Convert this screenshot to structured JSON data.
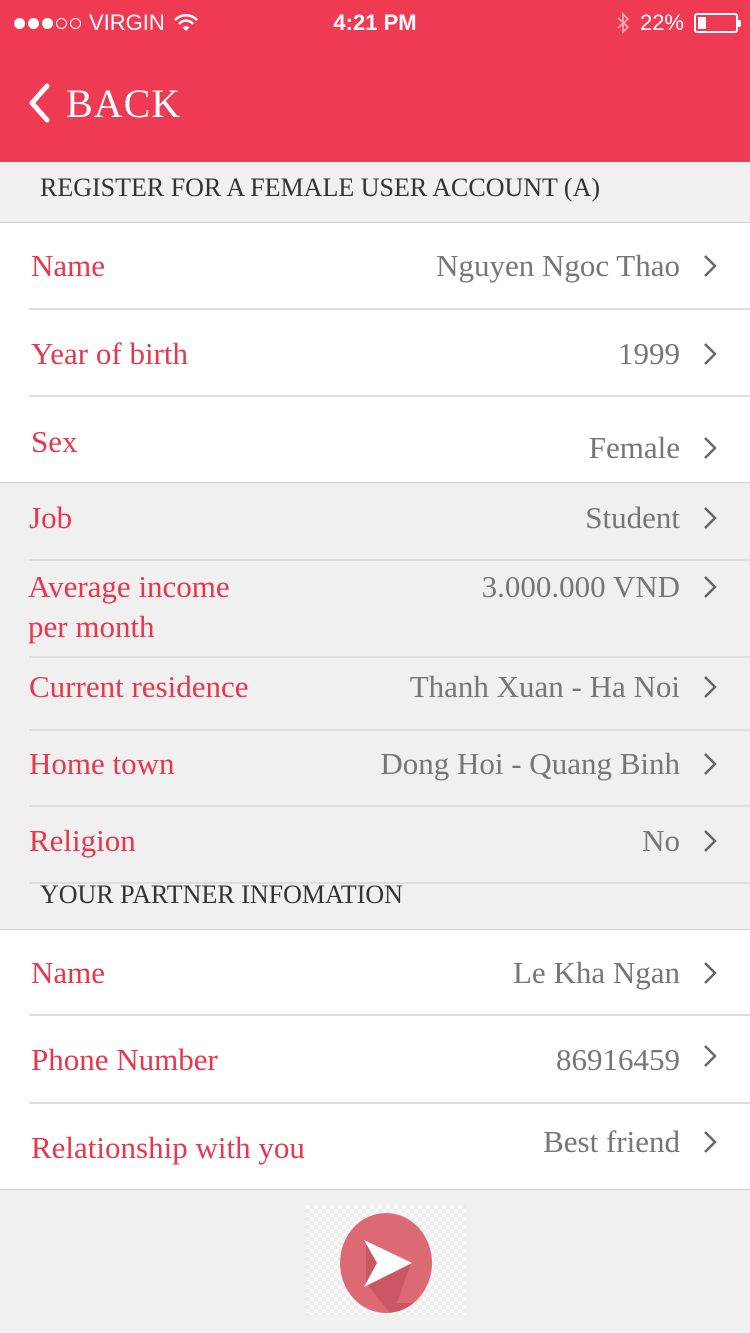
{
  "status_bar": {
    "carrier": "VIRGIN",
    "time": "4:21 PM",
    "battery": "22%",
    "battery_level": 0.22,
    "signal_bars": 3,
    "signal_total": 5,
    "icons": [
      "wifi-icon",
      "bluetooth-icon",
      "battery-icon"
    ]
  },
  "nav": {
    "back_label": "BACK",
    "back_icon": "chevron-left-icon"
  },
  "colors": {
    "accent": "#ee3a52",
    "label": "#e8364d",
    "value": "#767676"
  },
  "account_section": {
    "title": "REGISTER FOR A FEMALE USER ACCOUNT (A)",
    "fields": [
      {
        "label": "Name",
        "value": "Nguyen Ngoc Thao"
      },
      {
        "label": "Year of birth",
        "value": "1999"
      },
      {
        "label": "Sex",
        "value": "Female"
      },
      {
        "label": "Job",
        "value": "Student"
      },
      {
        "label_line1": "Average income",
        "label_line2": "per month",
        "value": "3.000.000 VND"
      },
      {
        "label": "Current residence",
        "value": "Thanh Xuan - Ha Noi"
      },
      {
        "label": "Home town",
        "value": "Dong Hoi - Quang Binh"
      },
      {
        "label": "Religion",
        "value": "No"
      }
    ]
  },
  "partner_section": {
    "title": "YOUR PARTNER INFOMATION",
    "fields": [
      {
        "label": "Name",
        "value": "Le Kha Ngan"
      },
      {
        "label": "Phone Number",
        "value": "86916459"
      },
      {
        "label": "Relationship with you",
        "value": "Best friend"
      }
    ]
  },
  "submit": {
    "icon": "arrow-right-icon"
  }
}
